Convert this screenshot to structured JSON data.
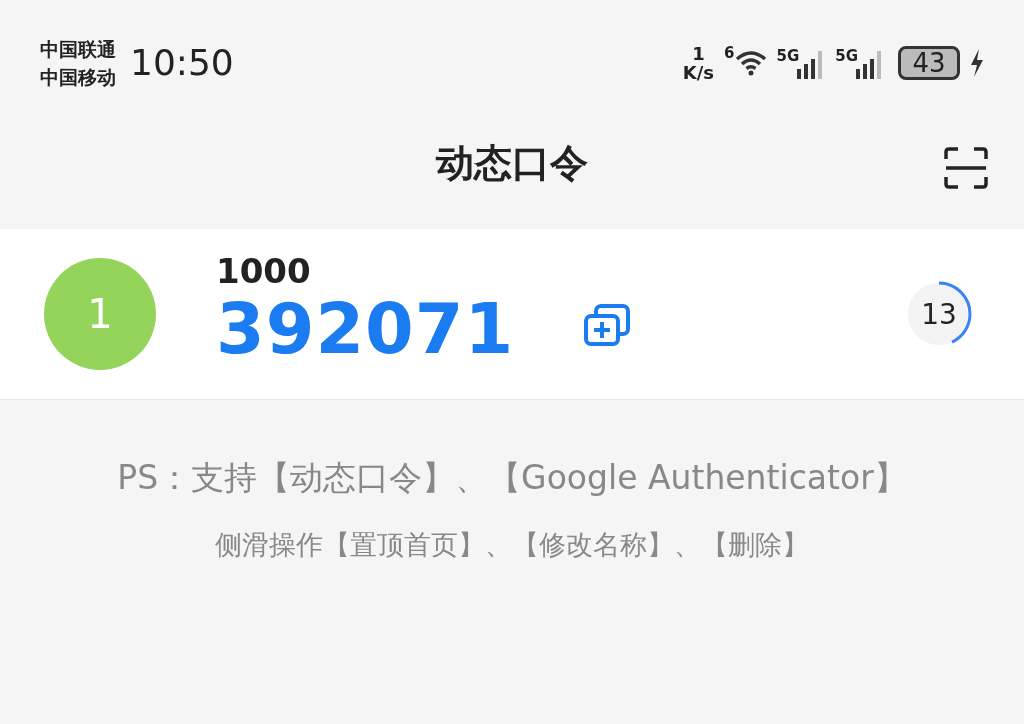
{
  "status_bar": {
    "carriers": [
      "中国联通",
      "中国移动"
    ],
    "time": "10:50",
    "net_speed": {
      "value": "1",
      "unit": "K/s"
    },
    "wifi_badge": "6",
    "signals": [
      {
        "label": "5G"
      },
      {
        "label": "5G"
      }
    ],
    "battery": "43"
  },
  "header": {
    "title": "动态口令"
  },
  "accounts": [
    {
      "avatar": "1",
      "color": "#95d45a",
      "name": "1000",
      "code": "392071",
      "timer": "13",
      "level": 0.43
    }
  ],
  "hints": [
    "PS：支持【动态口令】、【Google Authenticator】",
    "侧滑操作【置顶首页】、【修改名称】、【删除】"
  ]
}
